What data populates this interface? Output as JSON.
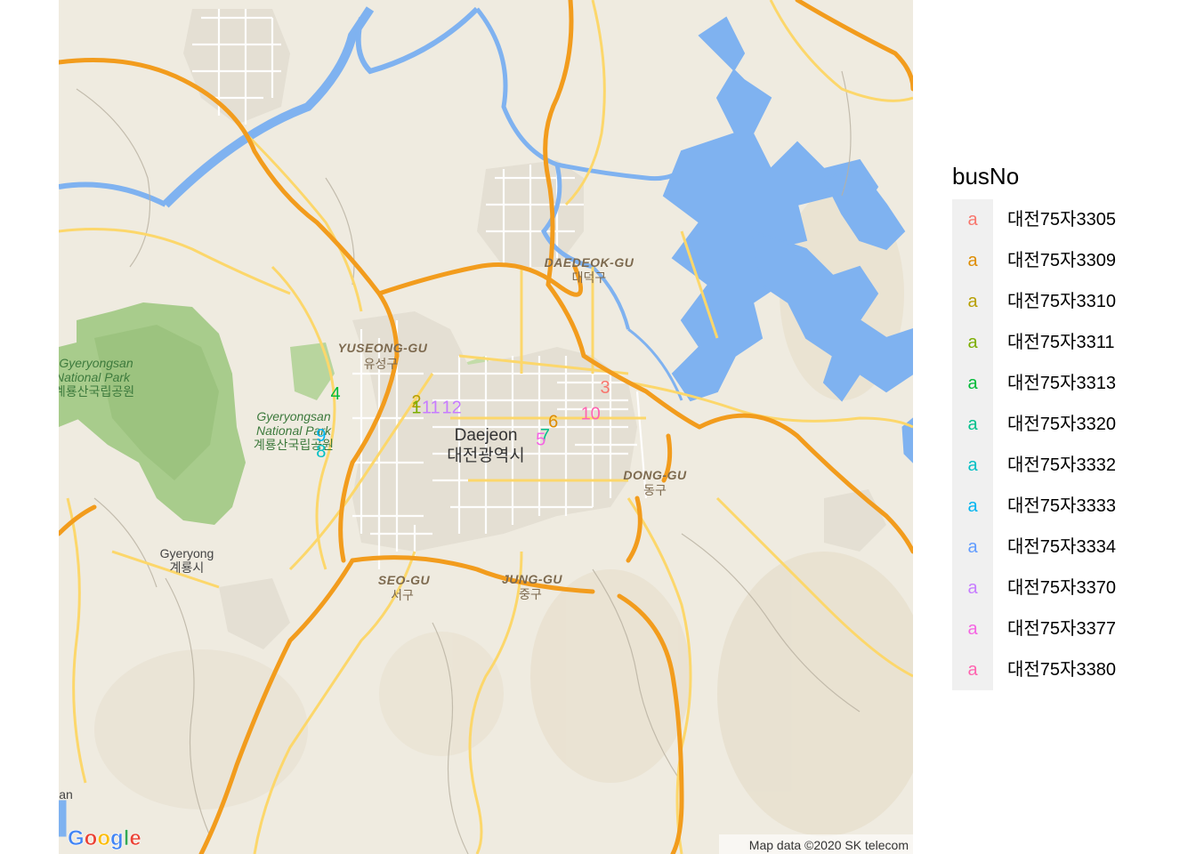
{
  "map": {
    "labels": {
      "daejeon_en": "Daejeon",
      "daejeon_ko": "대전광역시",
      "yuseong_en": "YUSEONG-GU",
      "yuseong_ko": "유성구",
      "daedeok_en": "DAEDEOK-GU",
      "daedeok_ko": "대덕구",
      "dong_en": "DONG-GU",
      "dong_ko": "동구",
      "seo_en": "SEO-GU",
      "seo_ko": "서구",
      "jung_en": "JUNG-GU",
      "jung_ko": "중구",
      "gyeryong_en": "Gyeryong",
      "gyeryong_ko": "계룡시",
      "park1_en_line1": "Gyeryongsan",
      "park1_en_line2": "National Park",
      "park1_ko": "계룡산국립공원",
      "park2_en_line1": "Gyeryongsan",
      "park2_en_line2": "National Park",
      "park2_ko": "계룡산국립공원",
      "edge_fragment": "an"
    },
    "google_logo": [
      "G",
      "o",
      "o",
      "g",
      "l",
      "e"
    ],
    "google_logo_colors": [
      "#4285F4",
      "#EA4335",
      "#FBBC05",
      "#4285F4",
      "#34A853",
      "#EA4335"
    ],
    "attribution": "Map data ©2020 SK telecom",
    "colors": {
      "land": "#efebe0",
      "water": "#7fb2f0",
      "park": "#a8cc8c",
      "park_light": "#c9ddb0",
      "highway": "#f29c1d",
      "major_road": "#fcd76b",
      "urban": "#e4dfd3"
    }
  },
  "points": [
    {
      "label": "3",
      "busNo": "대전75자3305",
      "lon": 127.455,
      "lat": 36.357
    },
    {
      "label": "10",
      "busNo": "대전75자3380",
      "lon": 127.448,
      "lat": 36.344
    },
    {
      "label": "6",
      "busNo": "대전75자3309",
      "lon": 127.43,
      "lat": 36.34
    },
    {
      "label": "7",
      "busNo": "대전75자3320",
      "lon": 127.426,
      "lat": 36.333
    },
    {
      "label": "5",
      "busNo": "대전75자3377",
      "lon": 127.424,
      "lat": 36.331
    },
    {
      "label": "2",
      "busNo": "대전75자3310",
      "lon": 127.364,
      "lat": 36.35
    },
    {
      "label": "1",
      "busNo": "대전75자3311",
      "lon": 127.364,
      "lat": 36.347
    },
    {
      "label": "11",
      "busNo": "대전75자3370",
      "lon": 127.371,
      "lat": 36.347
    },
    {
      "label": "12",
      "busNo": "대전75자3370",
      "lon": 127.381,
      "lat": 36.347
    },
    {
      "label": "4",
      "busNo": "대전75자3313",
      "lon": 127.325,
      "lat": 36.354
    },
    {
      "label": "9",
      "busNo": "대전75자3333",
      "lon": 127.318,
      "lat": 36.333
    },
    {
      "label": "8",
      "busNo": "대전75자3332",
      "lon": 127.318,
      "lat": 36.325
    }
  ],
  "legend": {
    "title": "busNo",
    "key_glyph": "a",
    "items": [
      {
        "label": "대전75자3305",
        "color": "#F8766D"
      },
      {
        "label": "대전75자3309",
        "color": "#DE8C00"
      },
      {
        "label": "대전75자3310",
        "color": "#B79F00"
      },
      {
        "label": "대전75자3311",
        "color": "#7CAE00"
      },
      {
        "label": "대전75자3313",
        "color": "#00BA38"
      },
      {
        "label": "대전75자3320",
        "color": "#00C08B"
      },
      {
        "label": "대전75자3332",
        "color": "#00BFC4"
      },
      {
        "label": "대전75자3333",
        "color": "#00B4F0"
      },
      {
        "label": "대전75자3334",
        "color": "#619CFF"
      },
      {
        "label": "대전75자3370",
        "color": "#C77CFF"
      },
      {
        "label": "대전75자3377",
        "color": "#F564E3"
      },
      {
        "label": "대전75자3380",
        "color": "#FF64B0"
      }
    ]
  }
}
